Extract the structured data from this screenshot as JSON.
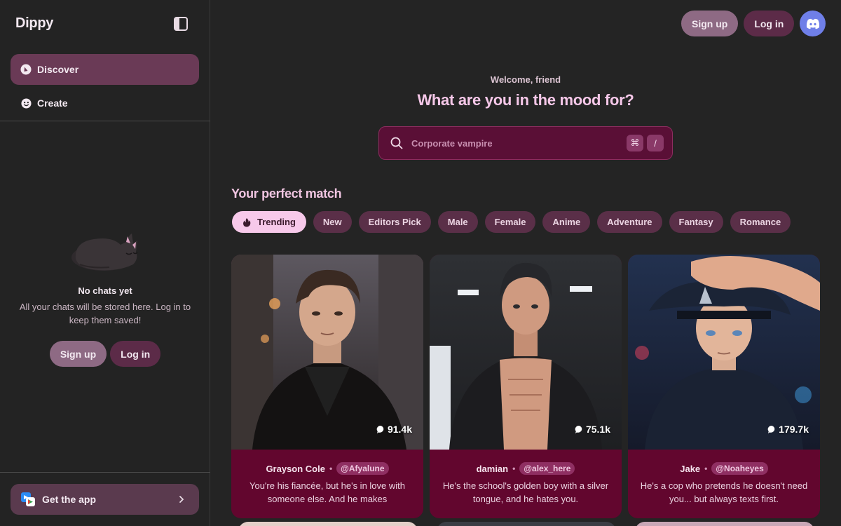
{
  "app": {
    "brand": "Dippy"
  },
  "sidebar": {
    "nav": [
      {
        "label": "Discover",
        "icon": "compass-icon",
        "active": true
      },
      {
        "label": "Create",
        "icon": "smiley-icon",
        "active": false
      }
    ],
    "empty_state": {
      "title": "No chats yet",
      "description": "All your chats will be stored here. Log in to keep them saved!",
      "signup_label": "Sign up",
      "login_label": "Log in"
    },
    "get_app_label": "Get the app"
  },
  "header": {
    "signup_label": "Sign up",
    "login_label": "Log in",
    "discord_icon": "discord-icon"
  },
  "hero": {
    "welcome": "Welcome, friend",
    "headline": "What are you in the mood for?",
    "search_placeholder": "Corporate vampire",
    "shortcut_keys": [
      "⌘",
      "/"
    ]
  },
  "section": {
    "title": "Your perfect match",
    "chips": [
      "Trending",
      "New",
      "Editors Pick",
      "Male",
      "Female",
      "Anime",
      "Adventure",
      "Fantasy",
      "Romance"
    ],
    "active_chip": "Trending"
  },
  "cards": [
    {
      "name": "Grayson Cole",
      "handle": "@Afyalune",
      "count": "91.4k",
      "description": "You're his fiancée, but he's in love with someone else. And he makes"
    },
    {
      "name": "damian",
      "handle": "@alex_here",
      "count": "75.1k",
      "description": "He's the school's golden boy with a silver tongue, and he hates you."
    },
    {
      "name": "Jake",
      "handle": "@Noaheyes",
      "count": "179.7k",
      "description": "He's a cop who pretends he doesn't need you... but always texts first."
    }
  ],
  "colors": {
    "accent": "#6a3a56",
    "card_bg": "#62062e",
    "headline": "#f5c7e8",
    "chip_active": "#f7c9ea"
  }
}
